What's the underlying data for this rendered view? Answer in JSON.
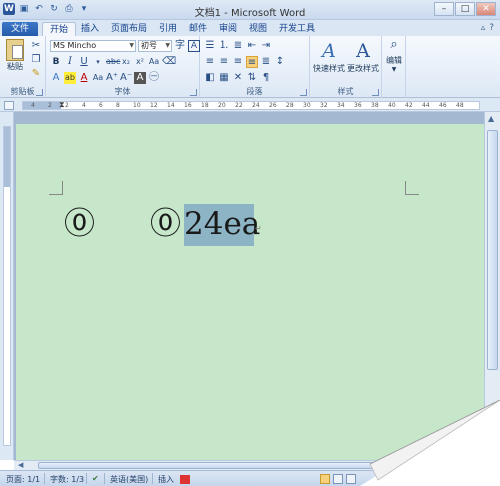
{
  "window": {
    "title": "文档1 - Microsoft Word",
    "min_glyph": "–",
    "max_glyph": "□",
    "close_glyph": "✕"
  },
  "ribbon_tabs": {
    "file": "文件",
    "home": "开始",
    "insert": "插入",
    "page_layout": "页面布局",
    "references": "引用",
    "mailings": "邮件",
    "review": "审阅",
    "view": "视图",
    "developer": "开发工具"
  },
  "clipboard": {
    "paste_label": "粘贴",
    "group_label": "剪贴板"
  },
  "font": {
    "name": "MS Mincho",
    "size": "初号",
    "group_label": "字体"
  },
  "paragraph": {
    "group_label": "段落"
  },
  "styles": {
    "quick_styles_label": "快速样式",
    "change_styles_label": "更改样式",
    "group_label": "样式"
  },
  "editing": {
    "label": "编辑"
  },
  "ruler": {
    "numbers": [
      "4",
      "2",
      "2",
      "4",
      "6",
      "8",
      "10",
      "12",
      "14",
      "16",
      "18",
      "20",
      "22",
      "24",
      "26",
      "28",
      "30",
      "32",
      "34",
      "36",
      "38",
      "40",
      "42",
      "44",
      "46",
      "48"
    ]
  },
  "document": {
    "text_left": "⓪",
    "text_right_prefix": "⓪",
    "selected_text": "24ea",
    "page_color": "#c7e7cb",
    "selection_color": "#8cb4c4"
  },
  "statusbar": {
    "page": "页面: 1/1",
    "words": "字数: 1/3",
    "language": "英语(美国)",
    "mode": "插入"
  }
}
